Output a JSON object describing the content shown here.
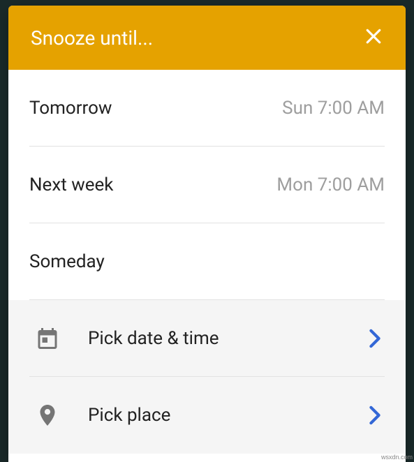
{
  "header": {
    "title": "Snooze until..."
  },
  "options": [
    {
      "label": "Tomorrow",
      "value": "Sun 7:00 AM"
    },
    {
      "label": "Next week",
      "value": "Mon 7:00 AM"
    },
    {
      "label": "Someday",
      "value": ""
    }
  ],
  "actions": {
    "pick_date": "Pick date & time",
    "pick_place": "Pick place"
  },
  "watermark": "wsxdn.com"
}
